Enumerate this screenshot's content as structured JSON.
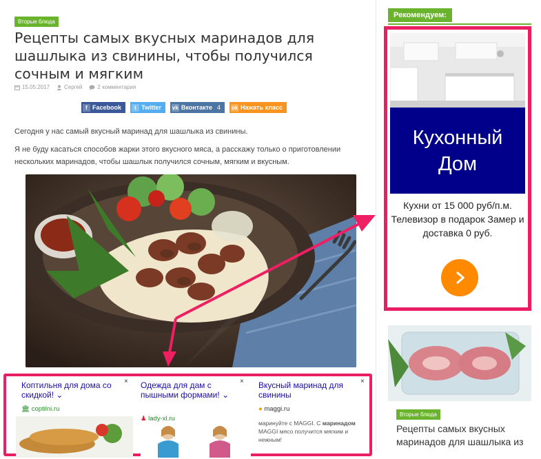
{
  "article": {
    "category": "Вторые блюда",
    "title": "Рецепты самых вкусных маринадов для шашлыка из свинины, чтобы получился сочным и мягким",
    "date": "15.05.2017",
    "author": "Сергей",
    "comments": "2 комментария",
    "paragraph1": "Сегодня у нас самый вкусный маринад для шашлыка из свинины.",
    "paragraph2": "Я не буду касаться способов жарки этого вкусного мяса, а расскажу только о приготовлении нескольких маринадов, чтобы шашлык получился сочным, мягким и вкусным."
  },
  "share": {
    "facebook": "Facebook",
    "twitter": "Twitter",
    "vk": "Вконтакте",
    "vk_count": "4",
    "ok": "Нажать класс"
  },
  "colors": {
    "accent_green": "#6ab42d",
    "highlight_pink": "#e91e63",
    "facebook": "#3b5998",
    "twitter": "#55acee",
    "vk": "#4c75a3",
    "ok": "#f7931e",
    "ad_brand": "#00008b",
    "ad_button": "#ff8a00"
  },
  "bottom_ads": [
    {
      "title": "Коптильня для дома со скидкой!",
      "domain": "coptilni.ru",
      "close": "×"
    },
    {
      "title": "Одежда для дам с пышными формами!",
      "domain": "lady-xl.ru",
      "close": "×"
    },
    {
      "title": "Вкусный маринад для свинины",
      "domain": "maggi.ru",
      "close": "×",
      "text_a": "маринуйте с MAGGI. С ",
      "text_b": "маринадом",
      "text_c": " MAGGI мясо получится мягким и нежным!"
    }
  ],
  "sidebar": {
    "heading": "Рекомендуем:",
    "ad": {
      "brand_line1": "Кухонный",
      "brand_line2": "Дом",
      "description": "Кухни от 15 000 руб/п.м. Телевизор в подарок Замер и доставка 0 руб.",
      "button_icon": "chevron-right-icon"
    },
    "related": {
      "category": "Вторые блюда",
      "title": "Рецепты самых вкусных маринадов для шашлыка из"
    }
  }
}
